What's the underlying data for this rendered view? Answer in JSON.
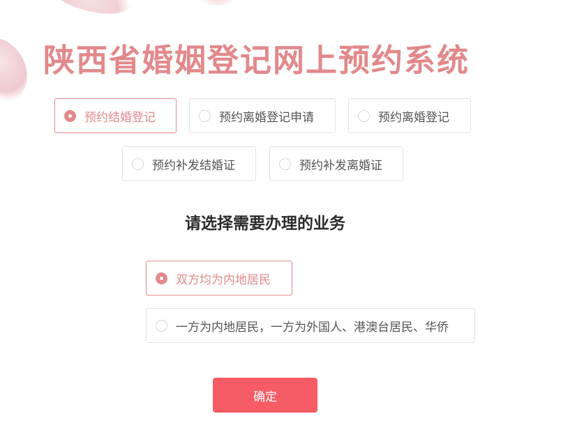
{
  "page": {
    "title": "陕西省婚姻登记网上预约系统"
  },
  "services": [
    {
      "label": "预约结婚登记",
      "selected": true
    },
    {
      "label": "预约离婚登记申请",
      "selected": false
    },
    {
      "label": "预约离婚登记",
      "selected": false
    },
    {
      "label": "预约补发结婚证",
      "selected": false
    },
    {
      "label": "预约补发离婚证",
      "selected": false
    }
  ],
  "business": {
    "heading": "请选择需要办理的业务",
    "options": [
      {
        "label": "双方均为内地居民",
        "selected": true
      },
      {
        "label": "一方为内地居民，一方为外国人、港澳台居民、华侨",
        "selected": false
      }
    ]
  },
  "actions": {
    "confirm_label": "确定"
  },
  "colors": {
    "accent": "#e2898b",
    "button": "#f55c66",
    "border": "#e2e2e2"
  }
}
